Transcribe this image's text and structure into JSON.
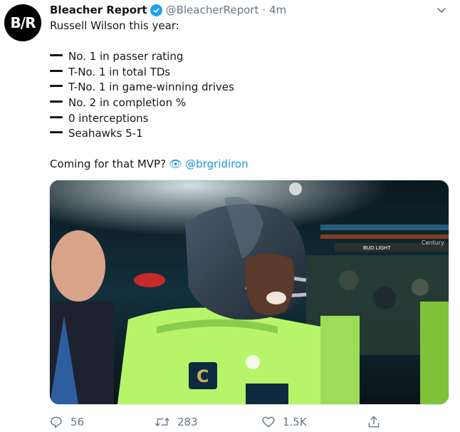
{
  "tweet": {
    "author_name": "Bleacher Report",
    "handle": "@BleacherReport",
    "separator": "·",
    "time": "4m",
    "avatar_text": "B/R",
    "lines": {
      "intro": "Russell Wilson this year:",
      "item1": "No. 1 in passer rating",
      "item2": "T-No. 1 in total TDs",
      "item3": "T-No. 1 in game-winning drives",
      "item4": "No. 2 in completion %",
      "item5": "0 interceptions",
      "item6": "Seahawks 5-1",
      "question": "Coming for that MVP?",
      "eye_emoji": "👁",
      "mention": "@brgridiron"
    },
    "actions": {
      "reply_count": "56",
      "retweet_count": "283",
      "like_count": "1.5K"
    }
  },
  "colors": {
    "accent": "#1da1f2",
    "link": "#1b95e0",
    "muted": "#657786",
    "jersey": "#b6f56a"
  },
  "icons": {
    "verified": "verified-badge-icon",
    "caret": "chevron-down-icon",
    "reply": "reply-icon",
    "retweet": "retweet-icon",
    "like": "heart-icon",
    "share": "share-icon"
  },
  "media": {
    "stadium_sign_1": "BUD LIGHT",
    "stadium_sign_2": "Century",
    "jersey_patch": "C"
  }
}
